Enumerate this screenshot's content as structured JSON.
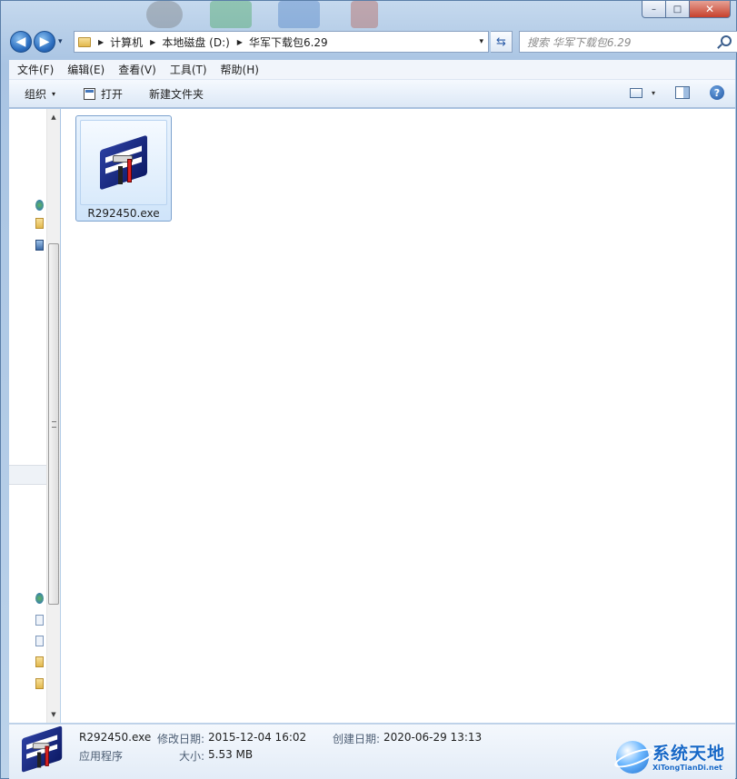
{
  "window": {
    "caption": {
      "min": "–",
      "max": "□",
      "close": "✕"
    }
  },
  "nav": {
    "back": "◀",
    "forward": "▶",
    "history": "▾",
    "breadcrumb": [
      "计算机",
      "本地磁盘 (D:)",
      "华军下载包6.29"
    ],
    "address_dropdown": "▾",
    "refresh": "⇆",
    "search_placeholder": "搜索 华军下载包6.29"
  },
  "menubar": {
    "items": [
      "文件(F)",
      "编辑(E)",
      "查看(V)",
      "工具(T)",
      "帮助(H)"
    ]
  },
  "cmdbar": {
    "organize": "组织",
    "organize_dd": "▾",
    "open": "打开",
    "new_folder": "新建文件夹",
    "view_dd": "▾",
    "help": "?"
  },
  "files": [
    {
      "name": "R292450.exe",
      "icon": "installer-app-icon"
    }
  ],
  "details": {
    "name": "R292450.exe",
    "type": "应用程序",
    "modified_label": "修改日期:",
    "modified_value": "2015-12-04 16:02",
    "size_label": "大小:",
    "size_value": "5.53 MB",
    "created_label": "创建日期:",
    "created_value": "2020-06-29 13:13"
  },
  "watermark": {
    "cn": "系统天地",
    "en": "XiTongTianDi.net"
  }
}
